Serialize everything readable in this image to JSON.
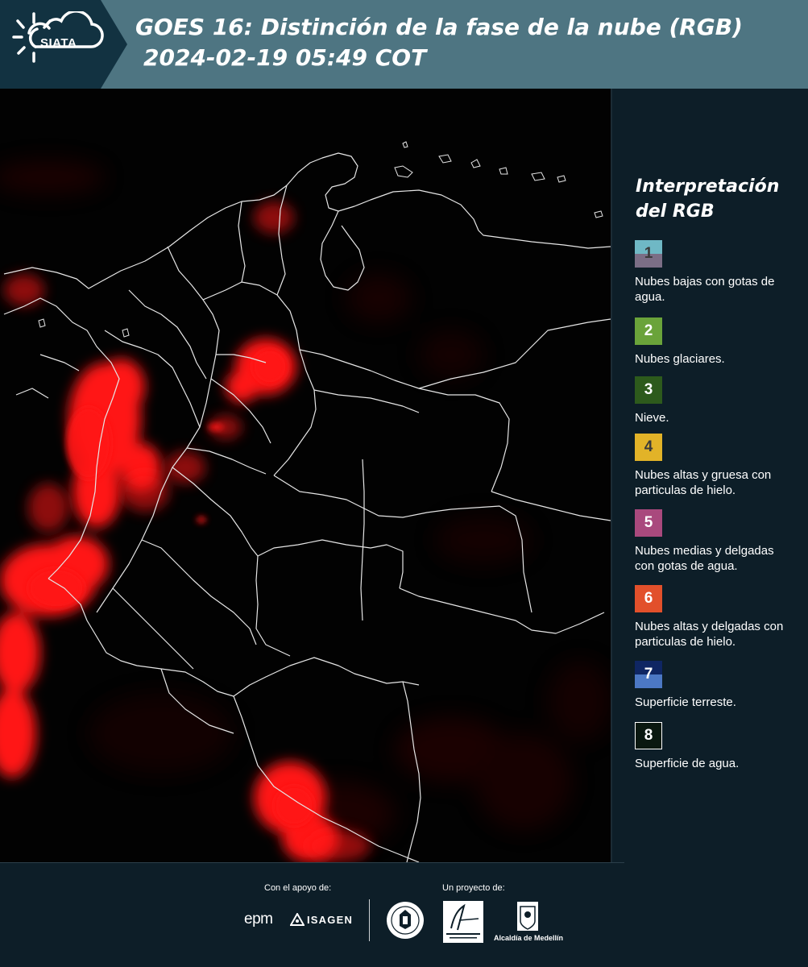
{
  "header": {
    "logo_text": "SIATA",
    "title": "GOES 16: Distinción de la fase de la nube (RGB)",
    "subtitle": "2024-02-19 05:49 COT"
  },
  "map": {
    "product": "GOES 16 RGB",
    "background_color": "#020202",
    "cloud_color": "#ff1a1a",
    "border_color": "#e6e6e6"
  },
  "legend": {
    "title": "Interpretación\ndel RGB",
    "items": [
      {
        "number": "1",
        "label": "Nubes bajas con gotas de agua.",
        "color_top": "#6fb8c5",
        "color_bottom": "#7b6e86",
        "number_color": "#3a3a3a"
      },
      {
        "number": "2",
        "label": "Nubes glaciares.",
        "color_top": "#6aa33a",
        "color_bottom": "#6aa33a",
        "number_color": "#ffffff"
      },
      {
        "number": "3",
        "label": "Nieve.",
        "color_top": "#2d5a1c",
        "color_bottom": "#2d5a1c",
        "number_color": "#ffffff"
      },
      {
        "number": "4",
        "label": "Nubes altas y gruesa con particulas de hielo.",
        "color_top": "#e2b328",
        "color_bottom": "#e2b328",
        "number_color": "#3a3a3a"
      },
      {
        "number": "5",
        "label": "Nubes medias y delgadas con gotas de agua.",
        "color_top": "#a9497d",
        "color_bottom": "#a9497d",
        "number_color": "#ffffff"
      },
      {
        "number": "6",
        "label": "Nubes altas y delgadas con particulas de hielo.",
        "color_top": "#e2502b",
        "color_bottom": "#e2502b",
        "number_color": "#ffffff"
      },
      {
        "number": "7",
        "label": "Superficie terreste.",
        "color_top": "#0f2663",
        "color_bottom": "#4c78c4",
        "number_color": "#ffffff"
      },
      {
        "number": "8",
        "label": "Superficie de agua.",
        "color_top": "#0a1810",
        "color_bottom": "#0a1810",
        "number_color": "#ffffff"
      }
    ]
  },
  "footer": {
    "support_label": "Con el apoyo de:",
    "project_label": "Un proyecto de:",
    "sponsor_1": "epm",
    "sponsor_2": "ISAGEN",
    "partner_3": "Alcaldía de Medellín"
  }
}
